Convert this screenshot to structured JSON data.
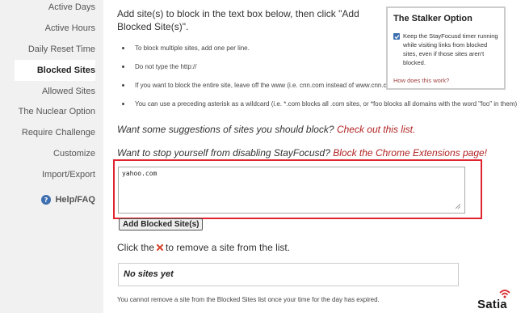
{
  "sidebar": {
    "items": [
      {
        "label": "Active Days"
      },
      {
        "label": "Active Hours"
      },
      {
        "label": "Daily Reset Time"
      },
      {
        "label": "Blocked Sites"
      },
      {
        "label": "Allowed Sites"
      },
      {
        "label": "The Nuclear Option"
      },
      {
        "label": "Require Challenge"
      },
      {
        "label": "Customize"
      },
      {
        "label": "Import/Export"
      }
    ],
    "active_index": 3,
    "help_label": "Help/FAQ"
  },
  "main": {
    "intro": "Add site(s) to block in the text box below, then click \"Add Blocked Site(s)\".",
    "tips": [
      "To block multiple sites, add one per line.",
      "Do not type the http://",
      "If you want to block the entire site, leave off the www (i.e. cnn.com instead of www.cnn.com)",
      "You can use a preceding asterisk as a wildcard (i.e. *.com blocks all .com sites, or *foo blocks all domains with the word \"foo\" in them)"
    ],
    "suggestion_text": "Want some suggestions of sites you should block?",
    "suggestion_link": "Check out this list.",
    "extensions_text": "Want to stop yourself from disabling StayFocusd?",
    "extensions_link": "Block the Chrome Extensions page!",
    "site_input_value": "yahoo.com",
    "add_button": "Add Blocked Site(s)",
    "remove_hint_before": "Click the",
    "remove_hint_after": "to remove a site from the list.",
    "sites_empty": "No sites yet",
    "footnote": "You cannot remove a site from the Blocked Sites list once your time for the day has expired."
  },
  "stalker": {
    "title": "The Stalker Option",
    "checked": true,
    "text": "Keep the StayFocusd timer running while visiting links from blocked sites, even if those sites aren't blocked.",
    "link": "How does this work?"
  },
  "watermark": {
    "text": "Satia"
  },
  "colors": {
    "sidebar_bg": "#f1f1f1",
    "link": "#b22222",
    "highlight": "#e0242f",
    "checkbox": "#3d6fb0"
  }
}
